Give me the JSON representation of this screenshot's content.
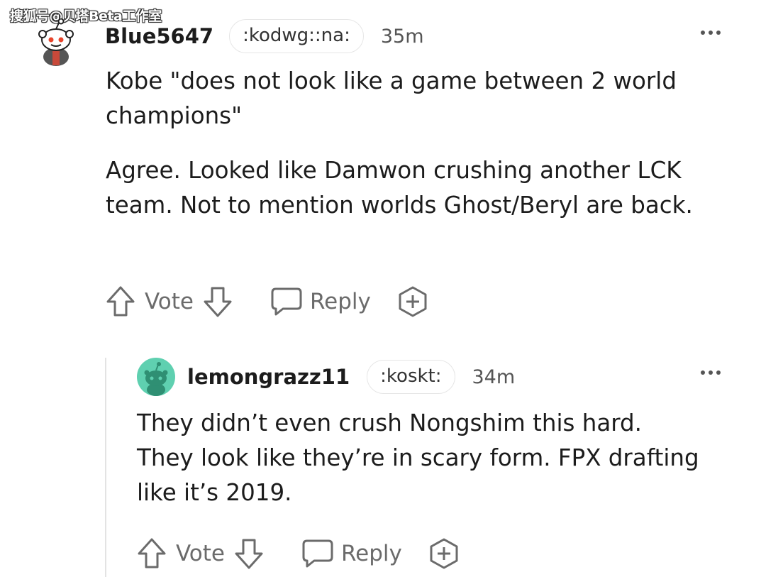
{
  "watermark": "搜狐号@贝塔Beta工作室",
  "comments": [
    {
      "username": "Blue5647",
      "flair": ":kodwg::na:",
      "time": "35m",
      "paragraphs": [
        "Kobe \"does not look like a game between 2 world champions\"",
        "Agree. Looked like Damwon crushing another LCK team. Not to mention worlds Ghost/Beryl are back."
      ],
      "actions": {
        "vote": "Vote",
        "reply": "Reply"
      }
    },
    {
      "username": "lemongrazz11",
      "flair": ":koskt:",
      "time": "34m",
      "paragraphs": [
        "They didn’t even crush Nongshim this hard. They look like they’re in scary form. FPX drafting like it’s 2019."
      ],
      "actions": {
        "vote": "Vote",
        "reply": "Reply"
      }
    }
  ],
  "icons": [
    "upvote-icon",
    "downvote-icon",
    "reply-icon",
    "award-icon",
    "more-options-icon"
  ],
  "colors": {
    "text": "#1c1c1c",
    "meta": "#6b6b6b",
    "reply_avatar_bg": "#5fd0b0"
  }
}
